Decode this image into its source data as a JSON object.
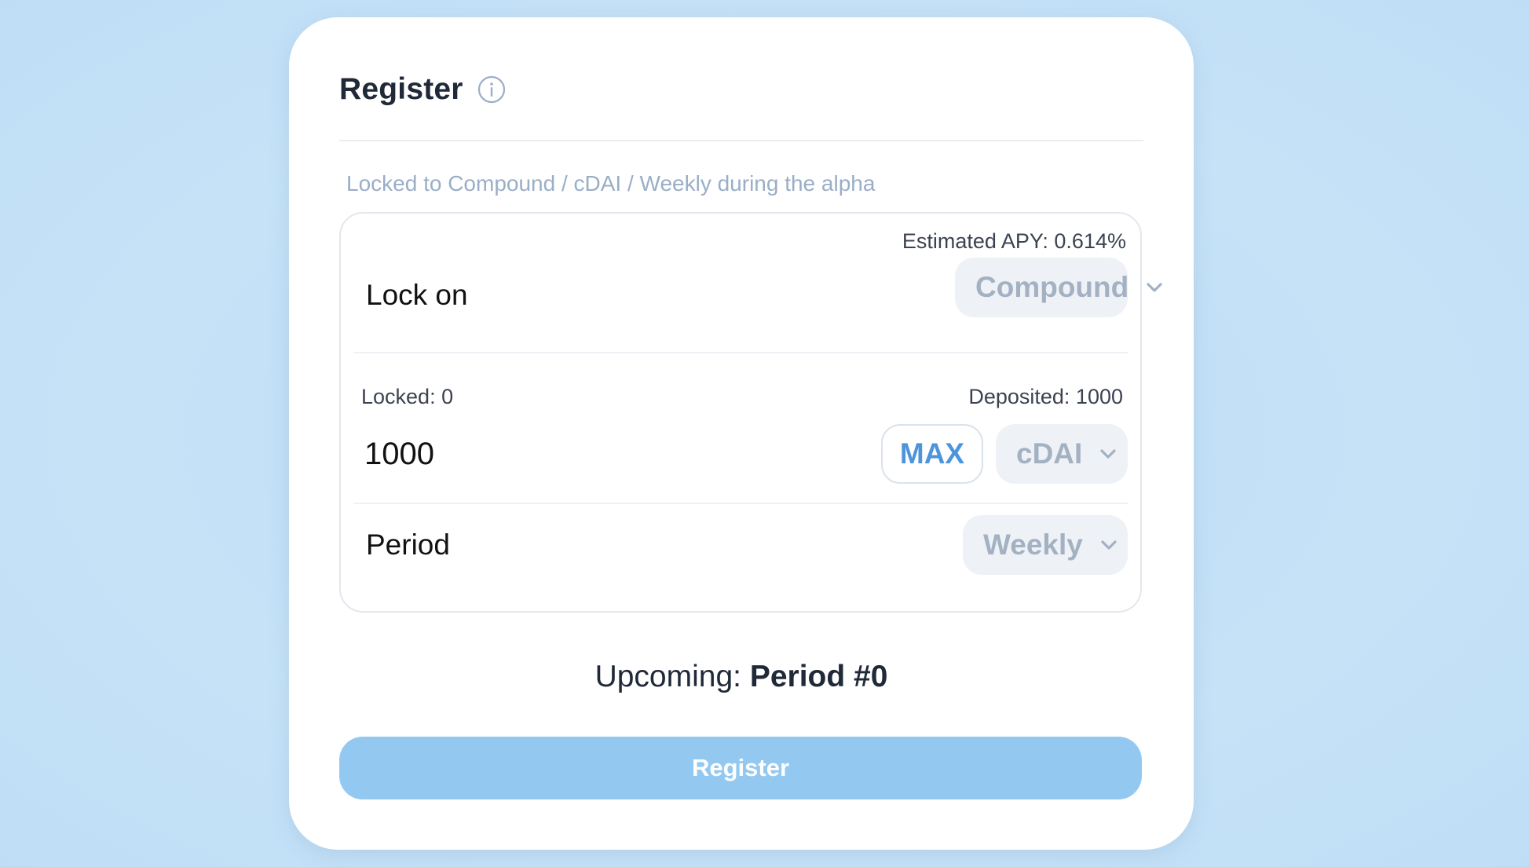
{
  "header": {
    "title": "Register"
  },
  "notice": "Locked to Compound / cDAI / Weekly during the alpha",
  "lock_row": {
    "label": "Lock on",
    "estimated_apy": "Estimated APY: 0.614%",
    "protocol": "Compound"
  },
  "amount_row": {
    "locked": "Locked: 0",
    "deposited": "Deposited: 1000",
    "value": "1000",
    "max_label": "MAX",
    "token": "cDAI"
  },
  "period_row": {
    "label": "Period",
    "value": "Weekly"
  },
  "upcoming": {
    "prefix": "Upcoming:",
    "value": "Period #0"
  },
  "register_button": "Register",
  "colors": {
    "accent": "#4c95dc",
    "button_bg": "#93c9f1",
    "page_bg": "#c1dff6",
    "muted_text": "#9aaec7",
    "select_bg": "#eef2f6"
  },
  "icons": {
    "info": "info-icon",
    "chevron": "chevron-down-icon"
  }
}
